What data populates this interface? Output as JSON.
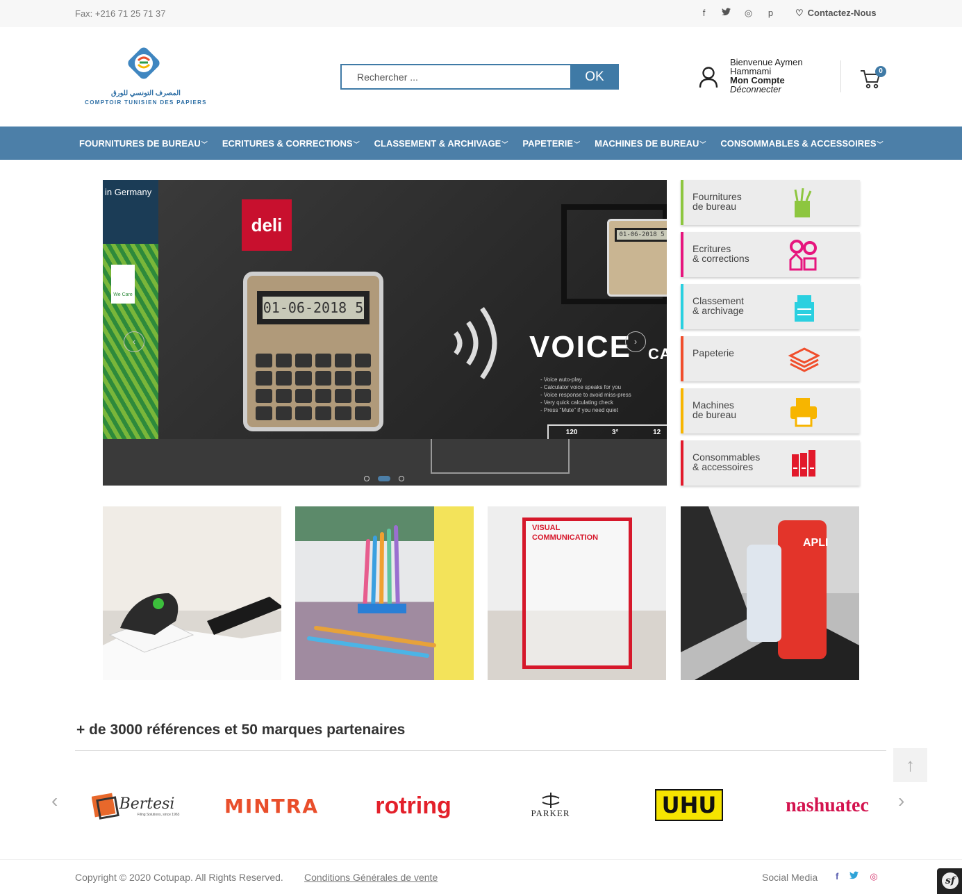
{
  "topbar": {
    "fax": "Fax: +216 71 25 71 37",
    "social_icons": [
      "facebook-icon",
      "twitter-icon",
      "instagram-icon",
      "pinterest-icon"
    ],
    "social_glyphs": [
      "f",
      "t",
      "◎",
      "p"
    ],
    "contact_label": "Contactez-Nous"
  },
  "logo": {
    "arabic": "المصرف التونسي للورق",
    "french": "COMPTOIR TUNISIEN DES PAPIERS"
  },
  "search": {
    "placeholder": "Rechercher ...",
    "button": "OK"
  },
  "account": {
    "welcome": "Bienvenue Aymen",
    "name": "Hammami",
    "my_account": "Mon Compte",
    "logout": "Déconnecter"
  },
  "cart": {
    "count": "0"
  },
  "nav": {
    "items": [
      "FOURNITURES DE BUREAU",
      "ECRITURES & CORRECTIONS",
      "CLASSEMENT & ARCHIVAGE",
      "PAPETERIE",
      "MACHINES DE BUREAU",
      "CONSOMMABLES & ACCESSOIRES"
    ]
  },
  "slider": {
    "left_caption": "in Germany",
    "left_badge": "We Care",
    "brand": "deli",
    "display": "01-06-2018 5",
    "headline": "VOICE",
    "subheadline": "CALCULA",
    "bullets": [
      "- Voice auto-play",
      "- Calculator voice speaks for you",
      "- Voice response to avoid miss-press",
      "- Very quick calculating check",
      "- Press \"Mute\" if you need quiet"
    ],
    "specs": [
      "120",
      "3°",
      "12"
    ],
    "slide_count": 3,
    "active_slide": 2
  },
  "categories": [
    {
      "label": "Fournitures\nde bureau",
      "color": "#8dc63f",
      "icon": "pencil-cup-icon"
    },
    {
      "label": "Ecritures\n& corrections",
      "color": "#e6157d",
      "icon": "pens-icon"
    },
    {
      "label": "Classement\n& archivage",
      "color": "#2ad0e0",
      "icon": "archive-box-icon"
    },
    {
      "label": "Papeterie",
      "color": "#f04e2c",
      "icon": "paper-stack-icon"
    },
    {
      "label": "Machines\nde bureau",
      "color": "#f7b500",
      "icon": "printer-icon"
    },
    {
      "label": "Consommables\n& accessoires",
      "color": "#e2192b",
      "icon": "binders-icon"
    }
  ],
  "promos": {
    "visual_communication": "VISUAL\nCOMMUNICATION",
    "apli": "APLI"
  },
  "brands": {
    "title": "+ de 3000 références et 50 marques partenaires",
    "items": [
      "Bertesi",
      "MINTRA",
      "rotring",
      "PARKER",
      "UHU",
      "nashuatec"
    ],
    "bertesi_tagline": "Filing Solutions, since 1963"
  },
  "footer": {
    "copyright": "Copyright © 2020 Cotupap. All Rights Reserved.",
    "cgv": "Conditions Générales de vente",
    "social_label": "Social Media",
    "social_colors": {
      "facebook": "#5b5fb0",
      "twitter": "#2ea3d8",
      "instagram": "#d4336c"
    }
  },
  "colors": {
    "primary": "#4c7fa8",
    "search_border": "#3f7aa6"
  }
}
